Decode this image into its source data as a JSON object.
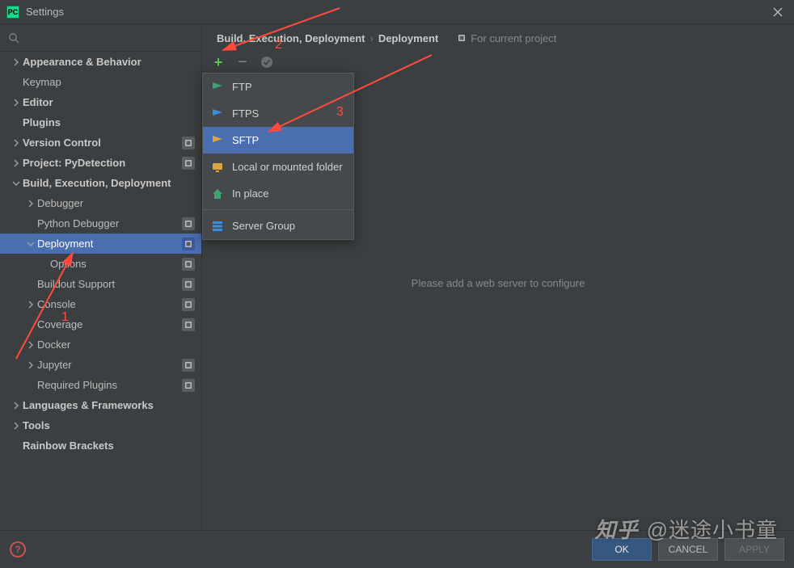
{
  "title": "Settings",
  "logo_text": "PC",
  "breadcrumb": {
    "root": "Build, Execution, Deployment",
    "leaf": "Deployment",
    "project_hint": "For current project"
  },
  "toolbar": {
    "add": "+",
    "remove": "−"
  },
  "sidebar": {
    "items": [
      {
        "label": "Appearance & Behavior",
        "lvl": 0,
        "bold": true,
        "arrow": ">"
      },
      {
        "label": "Keymap",
        "lvl": 0
      },
      {
        "label": "Editor",
        "lvl": 0,
        "bold": true,
        "arrow": ">"
      },
      {
        "label": "Plugins",
        "lvl": 0,
        "bold": true
      },
      {
        "label": "Version Control",
        "lvl": 0,
        "bold": true,
        "arrow": ">",
        "proj": true
      },
      {
        "label": "Project: PyDetection",
        "lvl": 0,
        "bold": true,
        "arrow": ">",
        "proj": true
      },
      {
        "label": "Build, Execution, Deployment",
        "lvl": 0,
        "bold": true,
        "arrow": "v"
      },
      {
        "label": "Debugger",
        "lvl": 1,
        "arrow": ">"
      },
      {
        "label": "Python Debugger",
        "lvl": 1,
        "proj": true
      },
      {
        "label": "Deployment",
        "lvl": 1,
        "arrow": "v",
        "proj": true,
        "active": true
      },
      {
        "label": "Options",
        "lvl": 2,
        "proj": true
      },
      {
        "label": "Buildout Support",
        "lvl": 1,
        "proj": true
      },
      {
        "label": "Console",
        "lvl": 1,
        "arrow": ">",
        "proj": true
      },
      {
        "label": "Coverage",
        "lvl": 1,
        "proj": true
      },
      {
        "label": "Docker",
        "lvl": 1,
        "arrow": ">"
      },
      {
        "label": "Jupyter",
        "lvl": 1,
        "arrow": ">",
        "proj": true
      },
      {
        "label": "Required Plugins",
        "lvl": 1,
        "proj": true
      },
      {
        "label": "Languages & Frameworks",
        "lvl": 0,
        "bold": true,
        "arrow": ">"
      },
      {
        "label": "Tools",
        "lvl": 0,
        "bold": true,
        "arrow": ">"
      },
      {
        "label": "Rainbow Brackets",
        "lvl": 0,
        "bold": true
      }
    ]
  },
  "popup": {
    "items": [
      {
        "label": "FTP",
        "icon": "flag-green"
      },
      {
        "label": "FTPS",
        "icon": "flag-blue"
      },
      {
        "label": "SFTP",
        "icon": "flag-yellow",
        "sel": true
      },
      {
        "label": "Local or mounted folder",
        "icon": "monitor"
      },
      {
        "label": "In place",
        "icon": "home"
      }
    ],
    "group_item": {
      "label": "Server Group",
      "icon": "servers"
    }
  },
  "center_message": "Please add a web server to configure",
  "buttons": {
    "ok": "OK",
    "cancel": "CANCEL",
    "apply": "APPLY"
  },
  "annotations": {
    "n1": "1",
    "n2": "2",
    "n3": "3"
  },
  "watermark": {
    "brand": "知乎",
    "author": "@迷途小书童"
  }
}
